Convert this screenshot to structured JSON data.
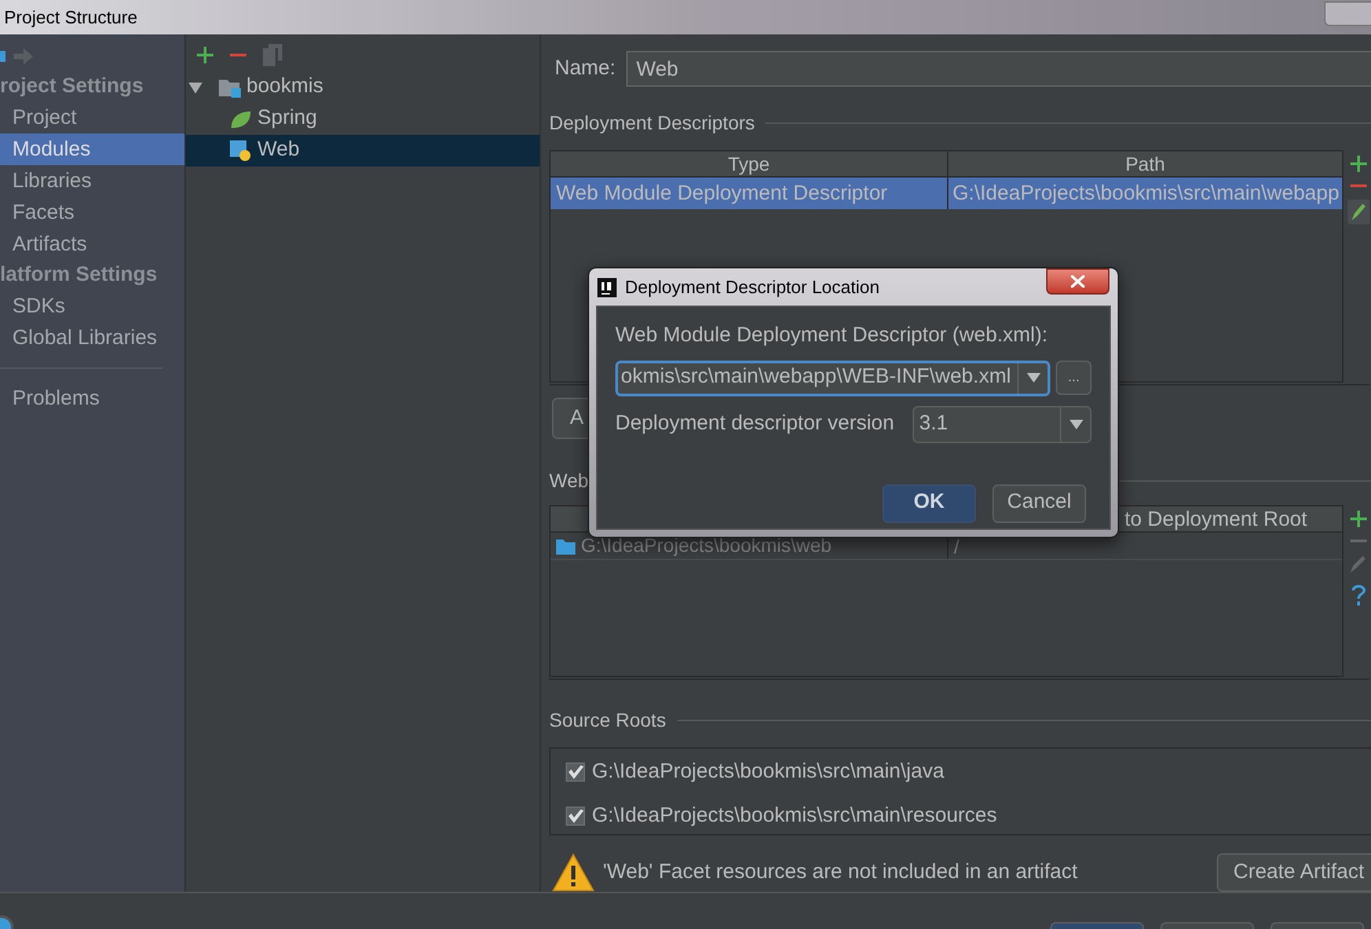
{
  "window": {
    "title": "Project Structure"
  },
  "sidebar": {
    "sections": [
      {
        "title": "roject Settings",
        "items": [
          {
            "label": "Project",
            "selected": false
          },
          {
            "label": "Modules",
            "selected": true
          },
          {
            "label": "Libraries",
            "selected": false
          },
          {
            "label": "Facets",
            "selected": false
          },
          {
            "label": "Artifacts",
            "selected": false
          }
        ]
      },
      {
        "title": "latform Settings",
        "items": [
          {
            "label": "SDKs",
            "selected": false
          },
          {
            "label": "Global Libraries",
            "selected": false
          }
        ]
      }
    ],
    "footer_items": [
      {
        "label": "Problems",
        "selected": false
      }
    ]
  },
  "module_tree": {
    "items": [
      {
        "label": "bookmis",
        "kind": "module",
        "expanded": true,
        "selected": false,
        "children": [
          {
            "label": "Spring",
            "kind": "spring",
            "selected": false
          },
          {
            "label": "Web",
            "kind": "web",
            "selected": true
          }
        ]
      }
    ]
  },
  "name_field": {
    "label": "Name:",
    "value": "Web"
  },
  "deployment_descriptors": {
    "title": "Deployment Descriptors",
    "columns": [
      "Type",
      "Path"
    ],
    "rows": [
      {
        "cells": [
          "Web Module Deployment Descriptor",
          "G:\\IdeaProjects\\bookmis\\src\\main\\webapp"
        ],
        "selected": true
      }
    ],
    "button": "A"
  },
  "web_resources": {
    "title": "Web",
    "columns": [
      "to Deployment Root"
    ],
    "rows": [
      {
        "cells": [
          "G:\\IdeaProjects\\bookmis\\web",
          "/"
        ],
        "selected": false
      }
    ]
  },
  "source_roots": {
    "title": "Source Roots",
    "items": [
      {
        "path": "G:\\IdeaProjects\\bookmis\\src\\main\\java",
        "checked": true
      },
      {
        "path": "G:\\IdeaProjects\\bookmis\\src\\main\\resources",
        "checked": true
      }
    ]
  },
  "warning": {
    "text": "'Web' Facet resources are not included in an artifact",
    "button": "Create Artifact"
  },
  "dialog": {
    "title": "Deployment Descriptor Location",
    "descriptor_label": "Web Module Deployment Descriptor (web.xml):",
    "descriptor_value": "okmis\\src\\main\\webapp\\WEB-INF\\web.xml",
    "browse": "...",
    "version_label": "Deployment descriptor version",
    "version_value": "3.1",
    "buttons": [
      {
        "label": "OK",
        "kind": "default"
      },
      {
        "label": "Cancel",
        "kind": "normal"
      }
    ]
  }
}
